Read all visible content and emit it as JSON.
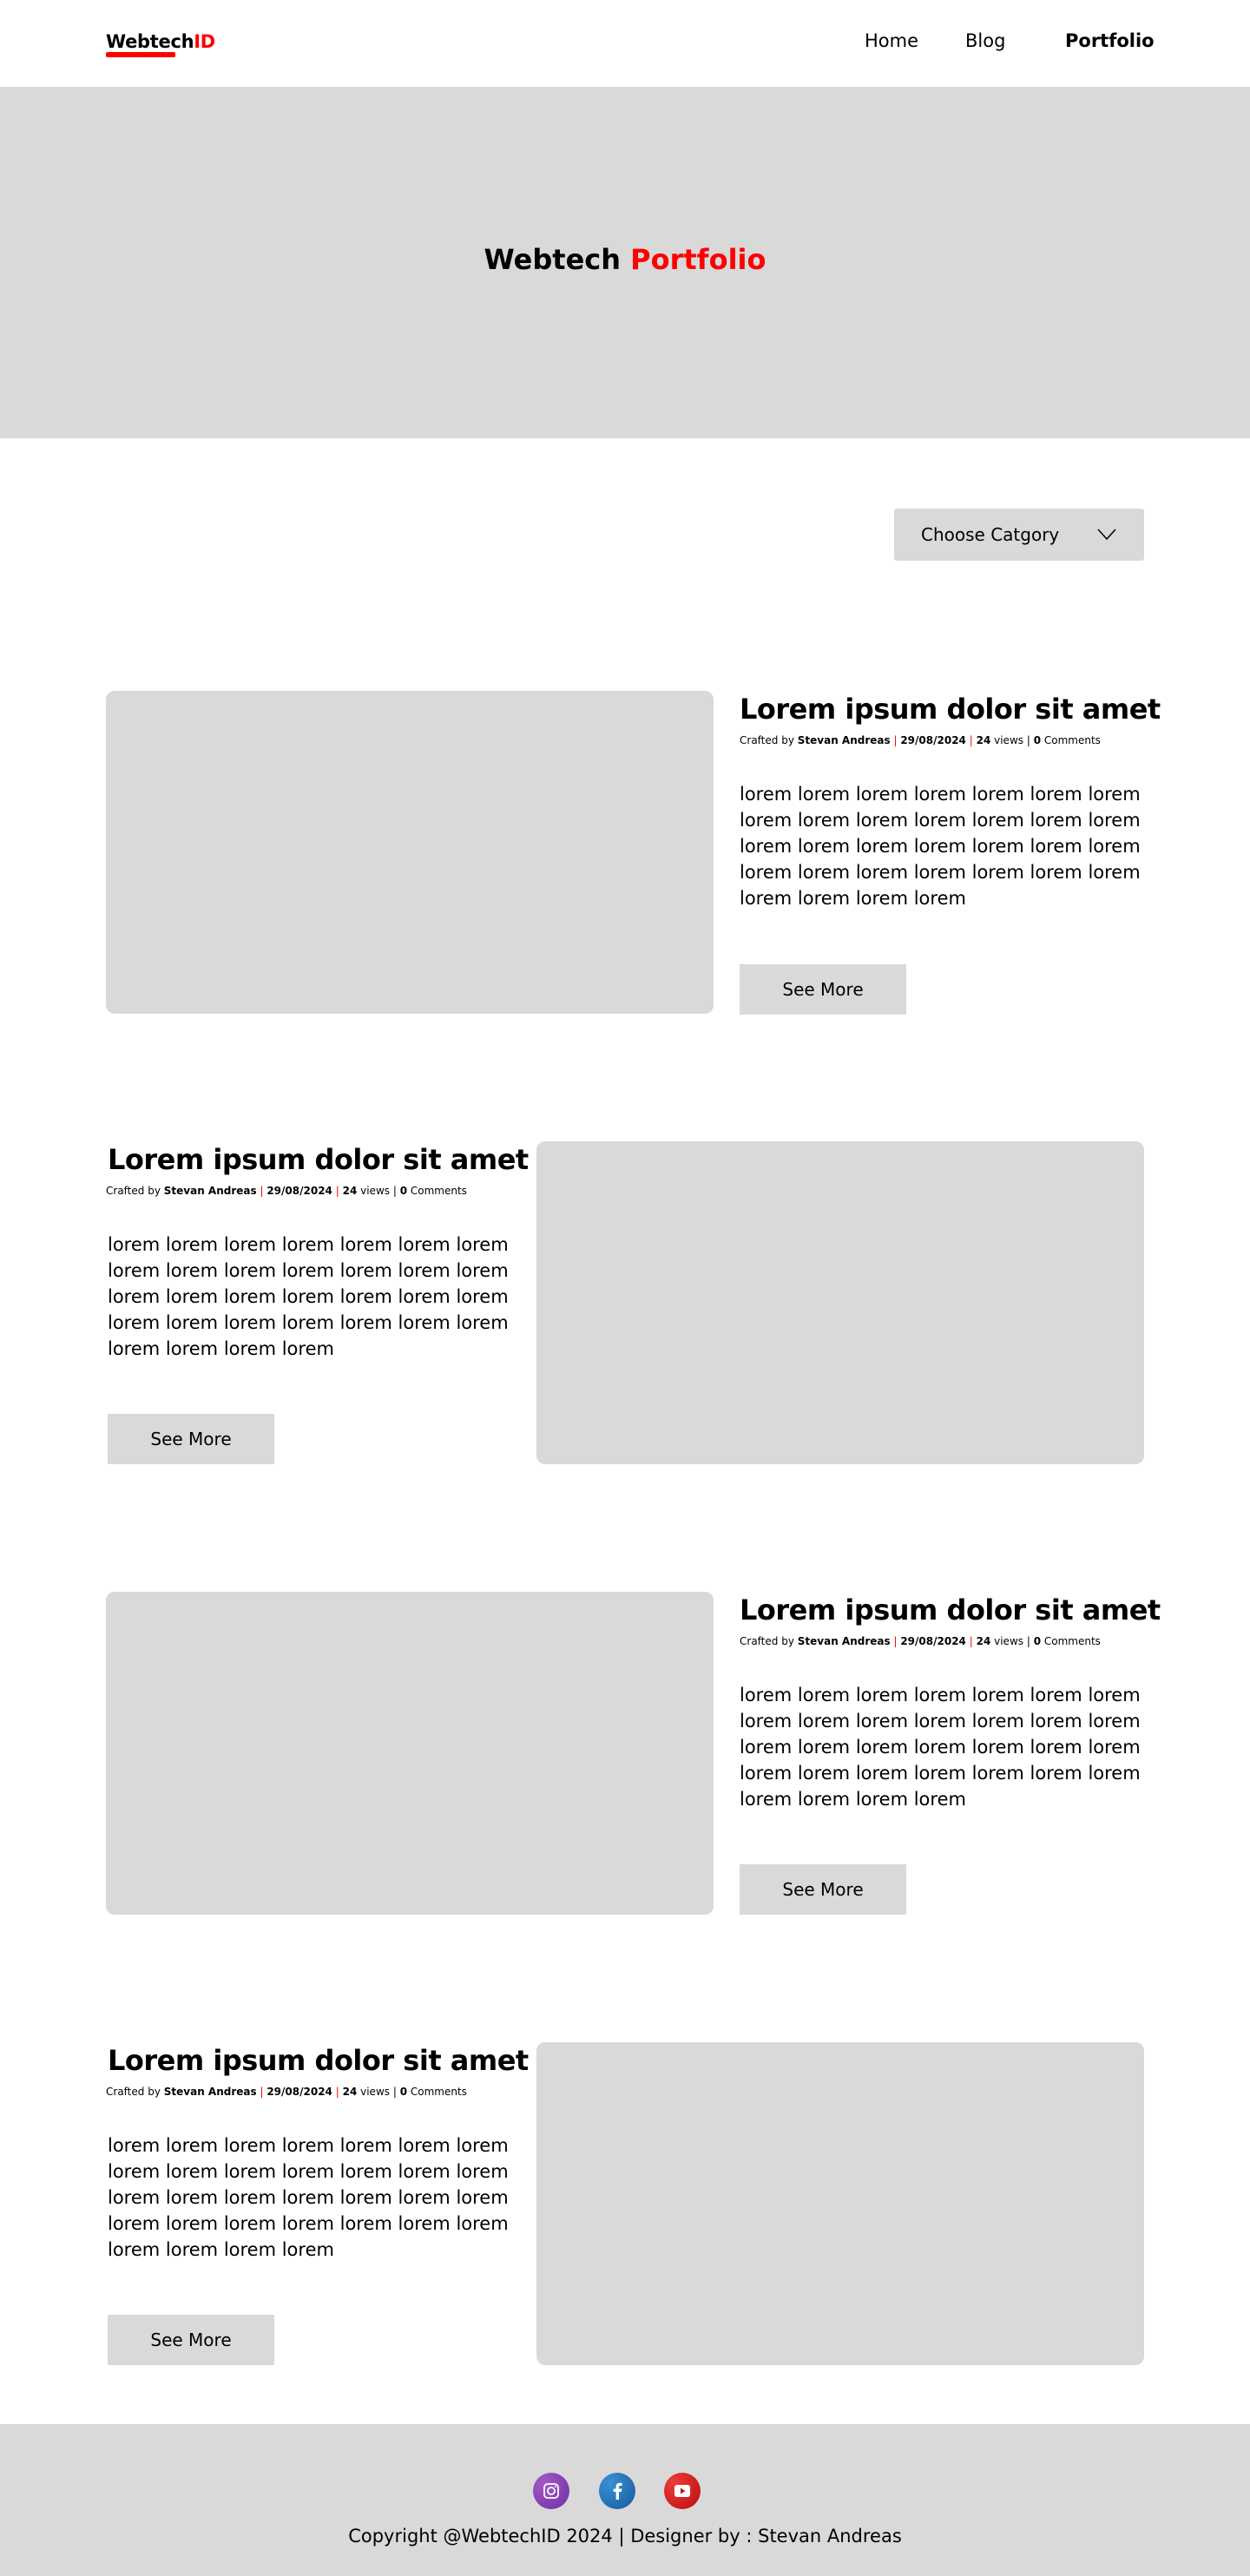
{
  "header": {
    "logo_part1": "Webtech",
    "logo_part2": "ID",
    "nav": [
      "Home",
      "Blog",
      "Portfolio"
    ]
  },
  "hero": {
    "title_part1": "Webtech",
    "title_part2": "Portfolio"
  },
  "filter": {
    "label": "Choose Catgory"
  },
  "posts": [
    {
      "title": "Lorem ipsum dolor sit amet",
      "crafted_by": "Crafted by",
      "author": "Stevan Andreas",
      "date": "29/08/2024",
      "views": "24",
      "views_label": "views",
      "comments": "0",
      "comments_label": "Comments",
      "body": "lorem lorem lorem lorem lorem lorem lorem lorem lorem lorem lorem lorem lorem lorem lorem lorem lorem lorem lorem lorem lorem lorem lorem lorem lorem lorem lorem lorem lorem lorem lorem lorem",
      "button": "See More"
    },
    {
      "title": "Lorem ipsum dolor sit amet",
      "crafted_by": "Crafted by",
      "author": "Stevan Andreas",
      "date": "29/08/2024",
      "views": "24",
      "views_label": "views",
      "comments": "0",
      "comments_label": "Comments",
      "body": "lorem lorem lorem lorem lorem lorem lorem lorem lorem lorem lorem lorem lorem lorem lorem lorem lorem lorem lorem lorem lorem lorem lorem lorem lorem lorem lorem lorem lorem lorem lorem lorem",
      "button": "See More"
    },
    {
      "title": "Lorem ipsum dolor sit amet",
      "crafted_by": "Crafted by",
      "author": "Stevan Andreas",
      "date": "29/08/2024",
      "views": "24",
      "views_label": "views",
      "comments": "0",
      "comments_label": "Comments",
      "body": "lorem lorem lorem lorem lorem lorem lorem lorem lorem lorem lorem lorem lorem lorem lorem lorem lorem lorem lorem lorem lorem lorem lorem lorem lorem lorem lorem lorem lorem lorem lorem lorem",
      "button": "See More"
    },
    {
      "title": "Lorem ipsum dolor sit amet",
      "crafted_by": "Crafted by",
      "author": "Stevan Andreas",
      "date": "29/08/2024",
      "views": "24",
      "views_label": "views",
      "comments": "0",
      "comments_label": "Comments",
      "body": "lorem lorem lorem lorem lorem lorem lorem lorem lorem lorem lorem lorem lorem lorem lorem lorem lorem lorem lorem lorem lorem lorem lorem lorem lorem lorem lorem lorem lorem lorem lorem lorem",
      "button": "See More"
    }
  ],
  "footer": {
    "social": [
      "instagram-icon",
      "facebook-icon",
      "youtube-icon"
    ],
    "copyright": "Copyright @WebtechID 2024 | Designer by : Stevan Andreas"
  },
  "colors": {
    "accent": "#ff0000",
    "placeholder_gray": "#d9d9d9"
  }
}
